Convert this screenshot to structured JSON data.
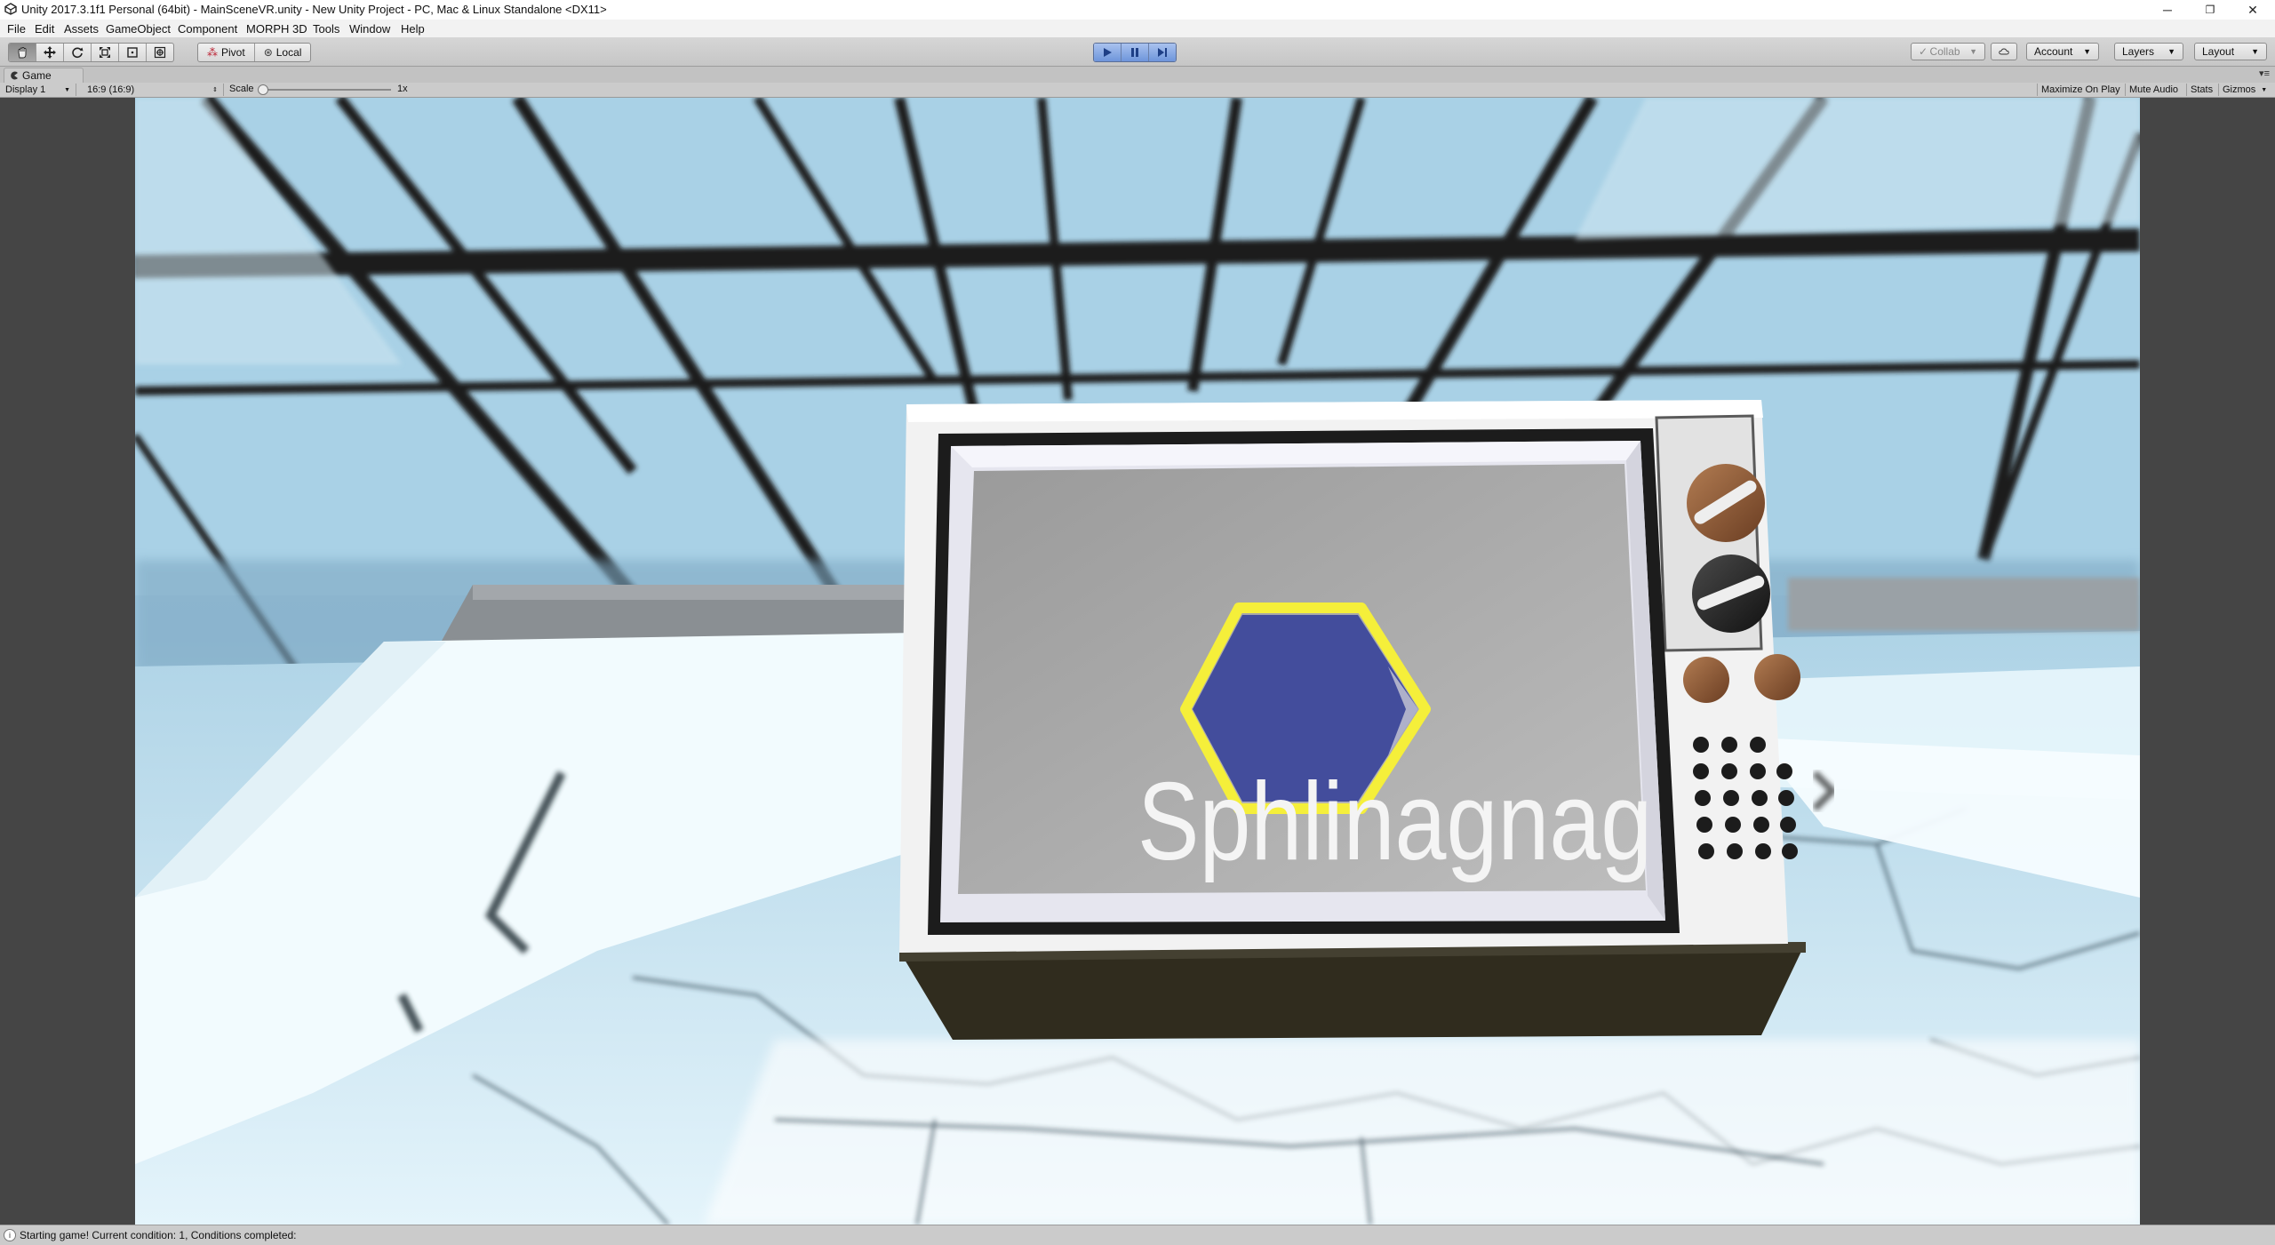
{
  "window": {
    "title": "Unity 2017.3.1f1 Personal (64bit) - MainSceneVR.unity - New Unity Project - PC, Mac & Linux Standalone <DX11>",
    "minimize_glyph": "─",
    "restore_glyph": "❐",
    "close_glyph": "✕"
  },
  "menu": {
    "items": [
      "File",
      "Edit",
      "Assets",
      "GameObject",
      "Component",
      "MORPH 3D",
      "Tools",
      "Window",
      "Help"
    ]
  },
  "toolbar": {
    "pivot_label": "Pivot",
    "local_label": "Local",
    "collab_label": "Collab",
    "account_label": "Account",
    "layers_label": "Layers",
    "layout_label": "Layout"
  },
  "game_panel": {
    "tab_label": "Game",
    "display_label": "Display 1",
    "aspect_label": "16:9 (16:9)",
    "scale_label": "Scale",
    "scale_value": "1x",
    "maximize_label": "Maximize On Play",
    "mute_label": "Mute Audio",
    "stats_label": "Stats",
    "gizmos_label": "Gizmos"
  },
  "scene": {
    "tv_text": "Sphlinagnag",
    "hexagon_color": "#434d9c",
    "hexagon_outline": "#f3f04a"
  },
  "status": {
    "message": "Starting game! Current condition: 1, Conditions completed:"
  },
  "colors": {
    "play_active": "#6e95db",
    "toolbar_bg": "#c9c9c9"
  }
}
